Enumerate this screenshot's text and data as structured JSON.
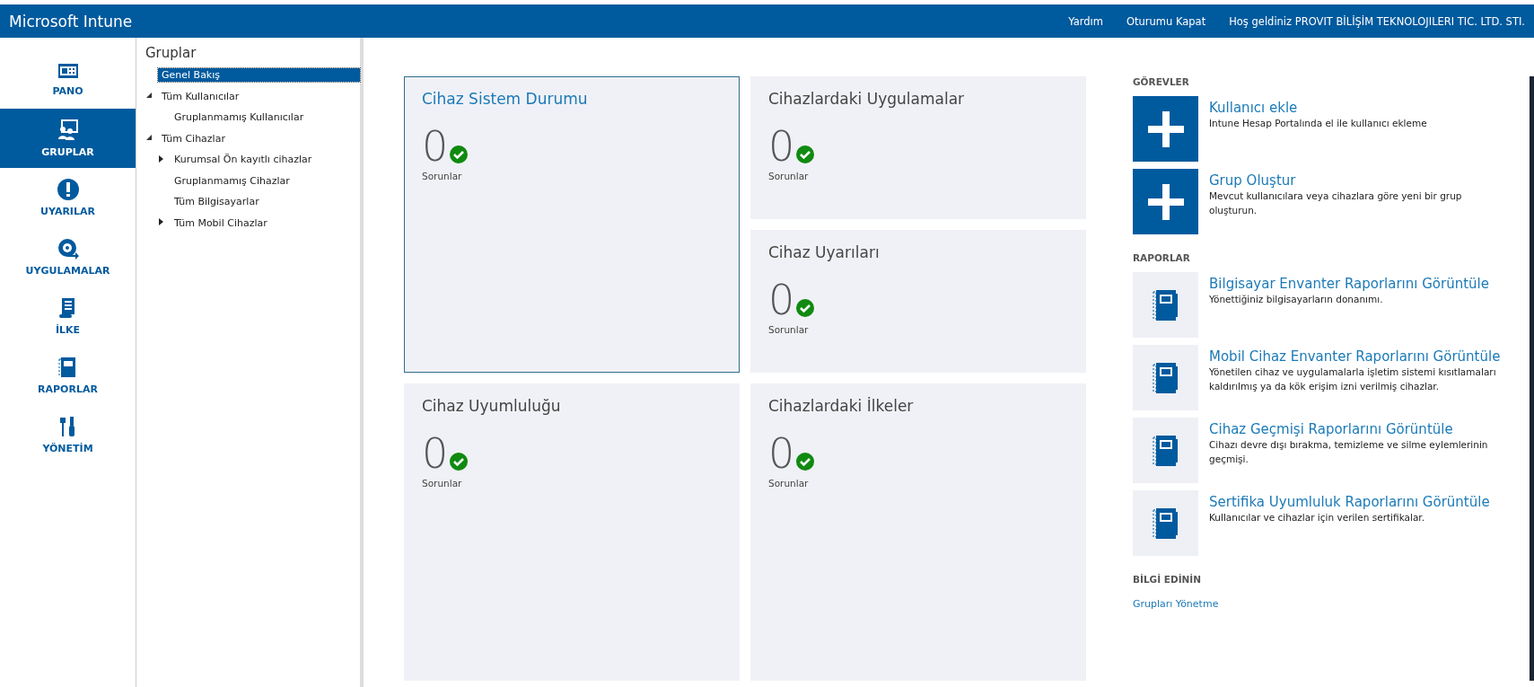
{
  "header": {
    "title": "Microsoft Intune",
    "links": [
      "Yardım",
      "Oturumu Kapat"
    ],
    "welcome": "Hoş geldiniz PROVIT BİLİŞİM TEKNOLOJILERI TIC. LTD. STI."
  },
  "nav": [
    {
      "kind": "dashboard",
      "label": "PANO",
      "selected": false
    },
    {
      "kind": "groups",
      "label": "GRUPLAR",
      "selected": true
    },
    {
      "kind": "alerts",
      "label": "UYARILAR",
      "selected": false
    },
    {
      "kind": "apps",
      "label": "UYGULAMALAR",
      "selected": false
    },
    {
      "kind": "policy",
      "label": "İLKE",
      "selected": false
    },
    {
      "kind": "reports",
      "label": "RAPORLAR",
      "selected": false
    },
    {
      "kind": "admin",
      "label": "YÖNETİM",
      "selected": false
    }
  ],
  "tree": {
    "title": "Gruplar",
    "items": [
      {
        "label": "Genel Bakış",
        "selected": true
      },
      {
        "label": "Tüm Kullanıcılar",
        "selected": false,
        "expanded": true,
        "children": [
          {
            "label": "Gruplanmamış Kullanıcılar",
            "selected": false
          }
        ]
      },
      {
        "label": "Tüm Cihazlar",
        "selected": false,
        "expanded": true,
        "children": [
          {
            "label": "Kurumsal Ön kayıtlı cihazlar",
            "selected": false,
            "expanded": false
          },
          {
            "label": "Gruplanmamış Cihazlar",
            "selected": false
          },
          {
            "label": "Tüm Bilgisayarlar",
            "selected": false
          },
          {
            "label": "Tüm Mobil Cihazlar",
            "selected": false,
            "expanded": false
          }
        ]
      }
    ]
  },
  "tiles": [
    {
      "title": "Cihaz Sistem Durumu",
      "count": "0",
      "caption": "Sorunlar",
      "selected": true
    },
    {
      "title": "Cihazlardaki Uygulamalar",
      "count": "0",
      "caption": "Sorunlar",
      "selected": false
    },
    {
      "title": "Cihaz Uyarıları",
      "count": "0",
      "caption": "Sorunlar",
      "selected": false
    },
    {
      "title": "Cihaz Uyumluluğu",
      "count": "0",
      "caption": "Sorunlar",
      "selected": false
    },
    {
      "title": "Cihazlardaki İlkeler",
      "count": "0",
      "caption": "Sorunlar",
      "selected": false
    }
  ],
  "tasks": {
    "heading": "GÖREVLER",
    "items": [
      {
        "kind": "add",
        "title": "Kullanıcı ekle",
        "description": "Intune Hesap Portalında el ile kullanıcı ekleme"
      },
      {
        "kind": "add",
        "title": "Grup Oluştur",
        "description": "Mevcut kullanıcılara veya cihazlara göre yeni bir grup oluşturun."
      }
    ]
  },
  "reports": {
    "heading": "RAPORLAR",
    "items": [
      {
        "kind": "report",
        "title": "Bilgisayar Envanter Raporlarını Görüntüle",
        "description": "Yönettiğiniz bilgisayarların donanımı."
      },
      {
        "kind": "report",
        "title": "Mobil Cihaz Envanter Raporlarını Görüntüle",
        "description": "Yönetilen cihaz ve uygulamalarla işletim sistemi kısıtlamaları kaldırılmış ya da kök erişim izni verilmiş cihazlar."
      },
      {
        "kind": "report",
        "title": "Cihaz Geçmişi Raporlarını Görüntüle",
        "description": "Cihazı devre dışı bırakma, temizleme ve silme eylemlerinin geçmişi."
      },
      {
        "kind": "report",
        "title": "Sertifika Uyumluluk Raporlarını Görüntüle",
        "description": "Kullanıcılar ve cihazlar için verilen sertifikalar."
      }
    ]
  },
  "learn": {
    "heading": "BİLGİ EDİNİN",
    "links": [
      "Grupları Yönetme"
    ]
  }
}
